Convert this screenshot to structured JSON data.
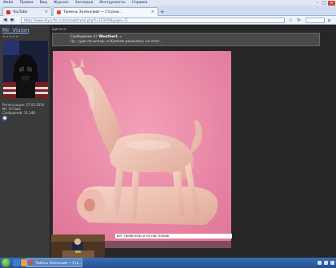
{
  "browser": {
    "menu": [
      "Файл",
      "Правка",
      "Вид",
      "Журнал",
      "Закладки",
      "Инструменты",
      "Справка"
    ],
    "tabs": [
      {
        "label": "YouTube",
        "active": false,
        "favicon_color": "#e02b20"
      },
      {
        "label": "Тюмень Зеленский — Страни...",
        "active": true,
        "favicon_color": "#e24a2b"
      }
    ],
    "new_tab_icon": "plus-icon",
    "url": "https://www.skyscrfor.com/showthread.php?t=123456&page=11"
  },
  "sidebar": {
    "username": "Mr_Vision",
    "rank_stars": "★★★★★",
    "info": {
      "registered": "Регистрация: 27.03.2010",
      "location": "Из: Оттава",
      "posts": "Сообщений: 11,248"
    }
  },
  "post": {
    "quote_label": "Цитата:",
    "quote_author_prefix": "Сообщение от ",
    "quote_author": "WeatherL",
    "quote_text": "Ну, судя по всему, в Кремле решились на этот...",
    "caption": "вот такой конь и на нас похож"
  },
  "taskbar": {
    "task_label": "Тюмень Зеленский — Стр..."
  }
}
